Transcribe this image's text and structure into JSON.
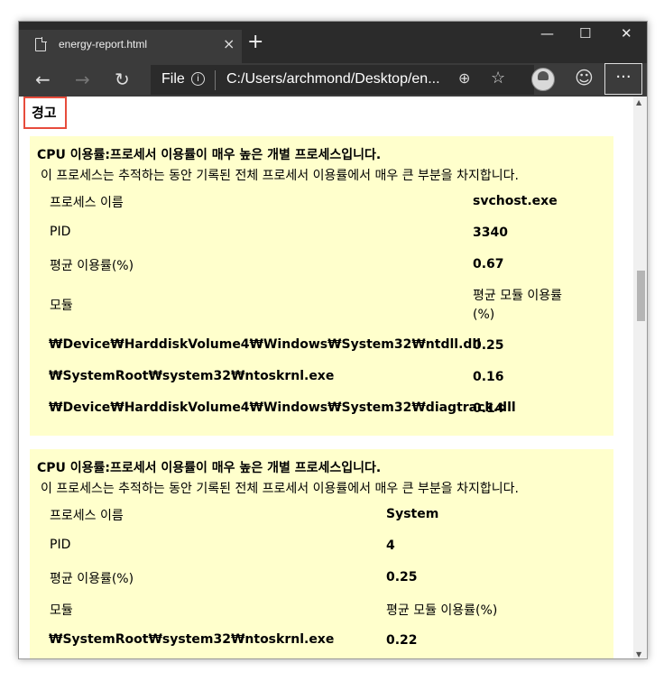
{
  "tab": {
    "title": "energy-report.html",
    "close": "×",
    "new_tab": "+"
  },
  "window_controls": {
    "minimize": "—",
    "maximize": "☐",
    "close": "✕"
  },
  "toolbar": {
    "back": "←",
    "forward": "→",
    "refresh": "↻",
    "scheme": "File",
    "info": "i",
    "url": "C:/Users/archmond/Desktop/en...",
    "zoom_icon": "⊕",
    "star_icon": "☆",
    "smiley_icon": "☺",
    "more": "···"
  },
  "scrollbar": {
    "up": "▲",
    "down": "▼"
  },
  "report": {
    "heading": "경고",
    "cards": [
      {
        "title": "CPU 이용률:프로세서 이용률이 매우 높은 개별 프로세스입니다.",
        "description": "이 프로세스는 추적하는 동안 기록된 전체 프로세서 이용률에서 매우 큰 부분을 차지합니다.",
        "process_name_label": "프로세스 이름",
        "process_name": "svchost.exe",
        "pid_label": "PID",
        "pid": "3340",
        "avg_usage_label": "평균 이용률(%)",
        "avg_usage": "0.67",
        "module_label": "모듈",
        "module_avg_label": "평균 모듈 이용률\n(%)",
        "modules": [
          {
            "name": "₩Device₩HarddiskVolume4₩Windows₩System32₩ntdll.dll",
            "value": "0.25"
          },
          {
            "name": "₩SystemRoot₩system32₩ntoskrnl.exe",
            "value": "0.16"
          },
          {
            "name": "₩Device₩HarddiskVolume4₩Windows₩System32₩diagtrack.dll",
            "value": "0.14"
          }
        ]
      },
      {
        "title": "CPU 이용률:프로세서 이용률이 매우 높은 개별 프로세스입니다.",
        "description": "이 프로세스는 추적하는 동안 기록된 전체 프로세서 이용률에서 매우 큰 부분을 차지합니다.",
        "process_name_label": "프로세스 이름",
        "process_name": "System",
        "pid_label": "PID",
        "pid": "4",
        "avg_usage_label": "평균 이용률(%)",
        "avg_usage": "0.25",
        "module_label": "모듈",
        "module_avg_label": "평균 모듈 이용률(%)",
        "modules": [
          {
            "name": "₩SystemRoot₩system32₩ntoskrnl.exe",
            "value": "0.22"
          }
        ]
      }
    ]
  }
}
